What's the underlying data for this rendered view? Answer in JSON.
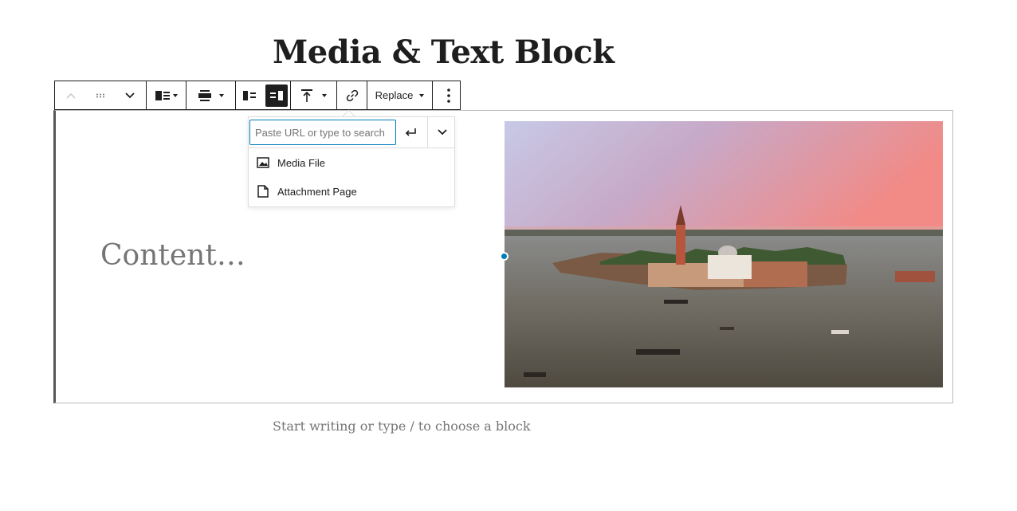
{
  "page": {
    "title": "Media & Text Block"
  },
  "toolbar": {
    "replace_label": "Replace"
  },
  "block": {
    "content_placeholder": "Content…",
    "image_alt": "aerial-view-of-island-church-in-lagoon"
  },
  "link_popover": {
    "url_placeholder": "Paste URL or type to search",
    "url_value": "",
    "suggestions": [
      {
        "label": "Media File",
        "icon": "image-icon"
      },
      {
        "label": "Attachment Page",
        "icon": "page-icon"
      }
    ]
  },
  "appender": {
    "placeholder": "Start writing or type / to choose a block"
  },
  "colors": {
    "accent": "#007cba",
    "text": "#1e1e1e",
    "placeholder": "#757575"
  }
}
